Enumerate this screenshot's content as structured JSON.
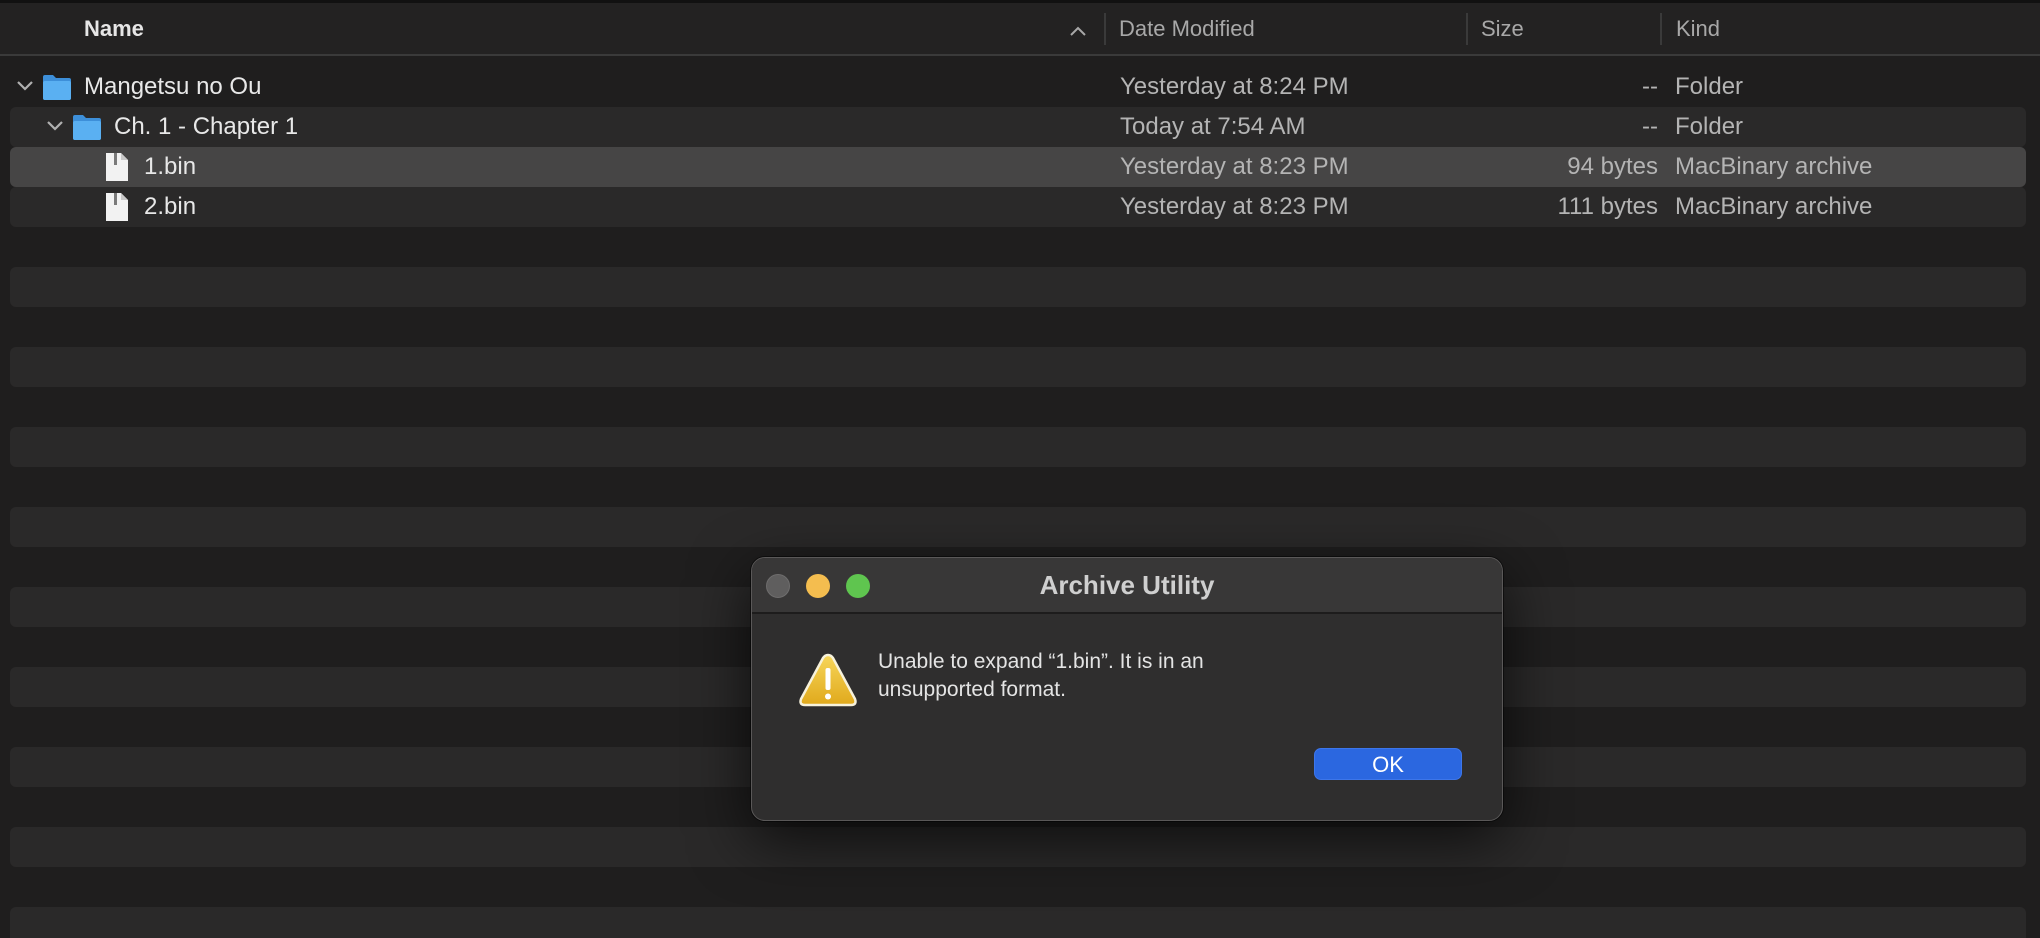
{
  "header": {
    "name_label": "Name",
    "date_label": "Date Modified",
    "size_label": "Size",
    "kind_label": "Kind"
  },
  "rows": [
    {
      "name": "Mangetsu no Ou",
      "date": "Yesterday at 8:24 PM",
      "size": "--",
      "kind": "Folder"
    },
    {
      "name": "Ch. 1 - Chapter 1",
      "date": "Today at 7:54 AM",
      "size": "--",
      "kind": "Folder"
    },
    {
      "name": "1.bin",
      "date": "Yesterday at 8:23 PM",
      "size": "94 bytes",
      "kind": "MacBinary archive"
    },
    {
      "name": "2.bin",
      "date": "Yesterday at 8:23 PM",
      "size": "111 bytes",
      "kind": "MacBinary archive"
    }
  ],
  "dialog": {
    "title": "Archive Utility",
    "message": "Unable to expand “1.bin”. It is in an unsupported format.",
    "ok_label": "OK"
  },
  "colors": {
    "folder": "#4ea6ee",
    "accent": "#2b67e0",
    "warning": "#f2c230"
  }
}
